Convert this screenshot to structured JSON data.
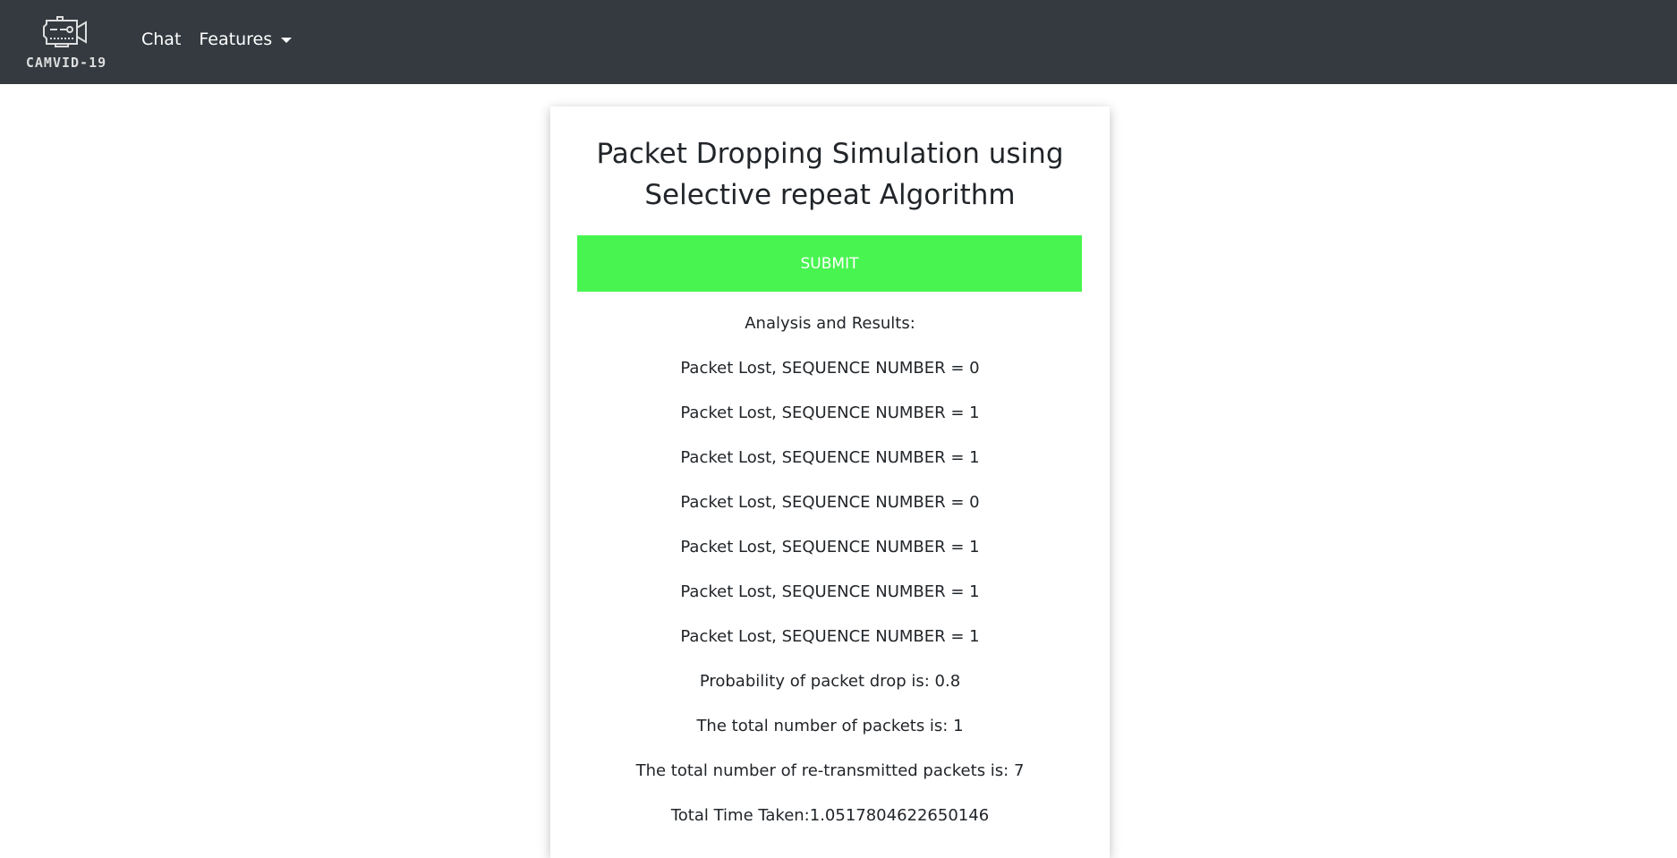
{
  "nav": {
    "brand": "CAMVID-19",
    "links": [
      "Chat",
      "Features"
    ]
  },
  "card": {
    "title_line1": "Packet Dropping Simulation using",
    "title_line2": "Selective repeat Algorithm",
    "submit_label": "SUBMIT",
    "results": [
      "Analysis and Results:",
      "Packet Lost, SEQUENCE NUMBER = 0",
      "Packet Lost, SEQUENCE NUMBER = 1",
      "Packet Lost, SEQUENCE NUMBER = 1",
      "Packet Lost, SEQUENCE NUMBER = 0",
      "Packet Lost, SEQUENCE NUMBER = 1",
      "Packet Lost, SEQUENCE NUMBER = 1",
      "Packet Lost, SEQUENCE NUMBER = 1",
      "Probability of packet drop is: 0.8",
      "The total number of packets is: 1",
      "The total number of re-transmitted packets is: 7",
      "Total Time Taken:1.0517804622650146"
    ]
  }
}
